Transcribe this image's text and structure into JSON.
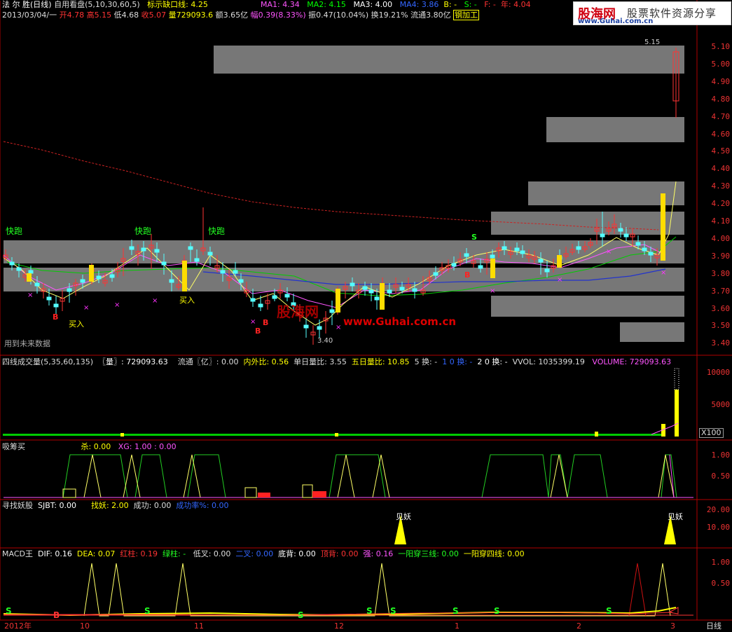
{
  "header": {
    "stock_name": "法 尔 胜(日线)",
    "indicator_main": "自用看盘(5,10,30,60,5)",
    "gap_line_label": "标示缺口线: 4.25",
    "ma1": "MA1: 4.34",
    "ma2": "MA2: 4.15",
    "ma3": "MA3: 4.00",
    "ma4": "MA4: 3.86",
    "b_label": "B: -",
    "s_label": "S: -",
    "f_label": "F: -",
    "year_label": "年: 4.04",
    "date": "2013/03/04/一",
    "open": "开4.78",
    "high": "高5.15",
    "low": "低4.68",
    "close": "收5.07",
    "volume": "量729093.6",
    "amount": "额3.65亿",
    "change": "幅0.39(8.33%)",
    "amplitude": "振0.47(10.04%)",
    "turnover": "换19.21%",
    "float": "流通3.80亿",
    "industry": "钢加工"
  },
  "logo": {
    "name": "股海网",
    "slogan": "股票软件资源分享",
    "url": "www.Guhai.com.cn"
  },
  "price_axis": [
    "5.10",
    "5.00",
    "4.90",
    "4.80",
    "4.70",
    "4.60",
    "4.50",
    "4.40",
    "4.30",
    "4.20",
    "4.10",
    "4.00",
    "3.90",
    "3.80",
    "3.70",
    "3.60",
    "3.50",
    "3.40"
  ],
  "chart_annotations": {
    "high_marker": "5.15",
    "low_marker": "3.40",
    "future_data_note": "用到未来数据",
    "watermark_cn": "股海网",
    "watermark_url": "www.Guhai.com.cn",
    "run_labels": [
      "快跑",
      "快跑",
      "快跑"
    ],
    "buy_label": "买入",
    "buy_label2": "买入"
  },
  "volume_panel": {
    "title": "四线成交量(5,35,60,135)",
    "vol": "〖量〗: 729093.63",
    "float": "流通〖亿〗: 0.00",
    "inout": "内外比: 0.56",
    "single_ratio": "单日量比: 3.55",
    "five_ratio": "五日量比: 10.85",
    "turn5": "5 换: -",
    "turn10": "1 0 换: -",
    "turn20": "2 0 换: -",
    "vvol": "VVOL: 1035399.19",
    "volume": "VOLUME: 729093.63",
    "axis": [
      "10000",
      "5000"
    ],
    "multiplier": "X100"
  },
  "absorb_panel": {
    "title": "吸筹买",
    "kill": "杀: 0.00",
    "xg": "XG: 1.00 : 0.00",
    "axis": [
      "1.00",
      "0.50"
    ]
  },
  "demon_panel": {
    "title": "寻找妖股",
    "sjbt": "SJBT: 0.00",
    "find": "找妖: 2.00",
    "success": "成功: 0.00",
    "rate": "成功率%: 0.00",
    "label": "见妖",
    "axis": [
      "20.00",
      "10.00"
    ]
  },
  "macd_panel": {
    "title": "MACD王",
    "dif": "DIF: 0.16",
    "dea": "DEA: 0.07",
    "red": "红柱: 0.19",
    "green": "绿柱: -",
    "low_cross": "低叉: 0.00",
    "double_cross": "二叉: 0.00",
    "bottom_div": "底背: 0.00",
    "top_div": "顶背: 0.00",
    "strong": "强: 0.16",
    "three_line": "一阳穿三线: 0.00",
    "four_line": "一阳穿四线: 0.00",
    "axis": [
      "1.00",
      "0.50"
    ]
  },
  "time_axis": {
    "labels": [
      "2012年",
      "10",
      "11",
      "12",
      "1",
      "2",
      "3"
    ],
    "period": "日线"
  },
  "colors": {
    "up": "#ff3333",
    "down": "#54ffff",
    "ma1": "#ffffff",
    "ma2": "#ffff00",
    "ma3": "#ff55ff",
    "ma4": "#00cc00",
    "axis": "#b00000",
    "band": "#777777"
  }
}
